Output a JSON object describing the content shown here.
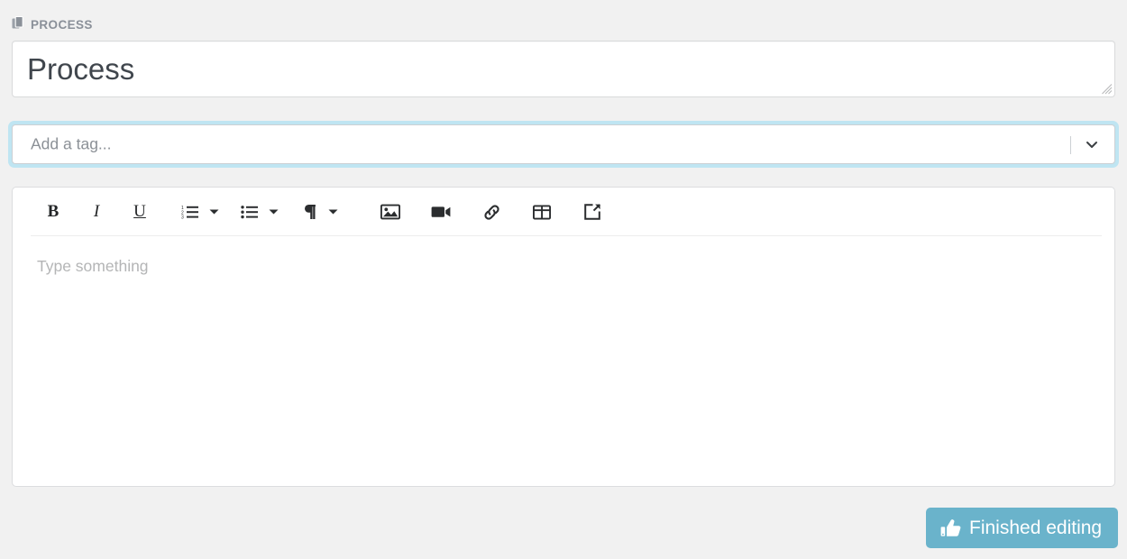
{
  "section": {
    "icon": "copy-documents-icon",
    "label": "PROCESS"
  },
  "title_field": {
    "value": "Process",
    "resize_handle": "textarea-resize-grip"
  },
  "tag_field": {
    "placeholder": "Add a tag...",
    "value": "",
    "dropdown_icon": "chevron-down-icon",
    "focused": true,
    "focus_ring_color": "#bfe5f2"
  },
  "editor": {
    "placeholder": "Type something",
    "content": "",
    "toolbar": [
      {
        "name": "bold-button",
        "label": "B",
        "type": "letter"
      },
      {
        "name": "italic-button",
        "label": "I",
        "type": "letter"
      },
      {
        "name": "underline-button",
        "label": "U",
        "type": "letter"
      },
      {
        "name": "ordered-list-button",
        "label": "",
        "type": "icon"
      },
      {
        "name": "ordered-list-dropdown-caret",
        "label": "",
        "type": "caret"
      },
      {
        "name": "unordered-list-button",
        "label": "",
        "type": "icon"
      },
      {
        "name": "unordered-list-dropdown-caret",
        "label": "",
        "type": "caret"
      },
      {
        "name": "paragraph-style-button",
        "label": "¶",
        "type": "icon"
      },
      {
        "name": "paragraph-style-dropdown-caret",
        "label": "",
        "type": "caret"
      },
      {
        "name": "insert-image-button",
        "label": "",
        "type": "icon"
      },
      {
        "name": "insert-video-button",
        "label": "",
        "type": "icon"
      },
      {
        "name": "insert-link-button",
        "label": "",
        "type": "icon"
      },
      {
        "name": "insert-table-button",
        "label": "",
        "type": "icon"
      },
      {
        "name": "popout-editor-button",
        "label": "",
        "type": "icon"
      }
    ]
  },
  "footer": {
    "finish_button_label": "Finished editing",
    "finish_button_icon": "thumbs-up-icon",
    "finish_button_color": "#6ab3cb"
  },
  "colors": {
    "page_background": "#f1f1f1",
    "panel_background": "#ffffff",
    "label_text": "#8a9099",
    "title_text": "#40464d",
    "placeholder_text": "#b4b5b6",
    "border": "#d9dadb",
    "accent": "#6ab3cb"
  }
}
